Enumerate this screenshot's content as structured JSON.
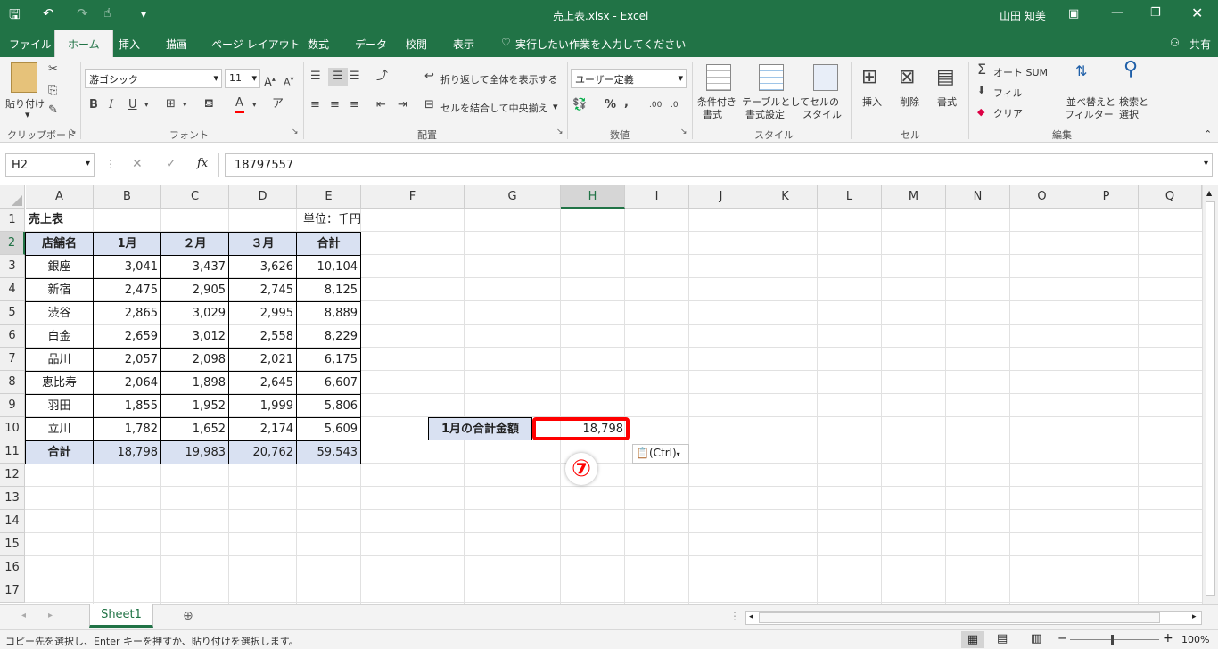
{
  "window": {
    "title": "売上表.xlsx - Excel",
    "user": "山田 知美"
  },
  "tabs": [
    "ファイル",
    "ホーム",
    "挿入",
    "描画",
    "ページ レイアウト",
    "数式",
    "データ",
    "校閲",
    "表示"
  ],
  "tell_me": "実行したい作業を入力してください",
  "share": "共有",
  "ribbon": {
    "clipboard": {
      "paste": "貼り付け",
      "label": "クリップボード"
    },
    "font": {
      "name": "游ゴシック",
      "size": "11",
      "label": "フォント"
    },
    "alignment": {
      "wrap": "折り返して全体を表示する",
      "merge": "セルを結合して中央揃え",
      "label": "配置"
    },
    "number": {
      "format": "ユーザー定義",
      "label": "数値"
    },
    "styles": {
      "cond": [
        "条件付き",
        "書式"
      ],
      "table": [
        "テーブルとして",
        "書式設定"
      ],
      "cell": [
        "セルの",
        "スタイル"
      ],
      "label": "スタイル"
    },
    "cells": {
      "insert": "挿入",
      "delete": "削除",
      "format": "書式",
      "label": "セル"
    },
    "editing": {
      "autosum": "オート SUM",
      "fill": "フィル",
      "clear": "クリア",
      "sort": [
        "並べ替えと",
        "フィルター"
      ],
      "find": [
        "検索と",
        "選択"
      ],
      "label": "編集"
    }
  },
  "formula_bar": {
    "name_box": "H2",
    "value": "18797557"
  },
  "columns": [
    "A",
    "B",
    "C",
    "D",
    "E",
    "F",
    "G",
    "H",
    "I",
    "J",
    "K",
    "L",
    "M",
    "N",
    "O",
    "P",
    "Q"
  ],
  "rows": [
    "1",
    "2",
    "3",
    "4",
    "5",
    "6",
    "7",
    "8",
    "9",
    "10",
    "11",
    "12",
    "13",
    "14",
    "15",
    "16",
    "17"
  ],
  "table": {
    "title": "売上表",
    "unit": "単位：千円",
    "headers": [
      "店舗名",
      "1月",
      "２月",
      "３月",
      "合計"
    ],
    "data": [
      [
        "銀座",
        "3,041",
        "3,437",
        "3,626",
        "10,104"
      ],
      [
        "新宿",
        "2,475",
        "2,905",
        "2,745",
        "8,125"
      ],
      [
        "渋谷",
        "2,865",
        "3,029",
        "2,995",
        "8,889"
      ],
      [
        "白金",
        "2,659",
        "3,012",
        "2,558",
        "8,229"
      ],
      [
        "品川",
        "2,057",
        "2,098",
        "2,021",
        "6,175"
      ],
      [
        "恵比寿",
        "2,064",
        "1,898",
        "2,645",
        "6,607"
      ],
      [
        "羽田",
        "1,855",
        "1,952",
        "1,999",
        "5,806"
      ],
      [
        "立川",
        "1,782",
        "1,652",
        "2,174",
        "5,609"
      ]
    ],
    "total": [
      "合計",
      "18,798",
      "19,983",
      "20,762",
      "59,543"
    ]
  },
  "side": {
    "label": "1月の合計金額",
    "value": "18,798"
  },
  "step_marker": "⑦",
  "paste_options": "(Ctrl)",
  "sheet_tab": "Sheet1",
  "status": {
    "message": "コピー先を選択し、Enter キーを押すか、貼り付けを選択します。",
    "zoom": "100%"
  },
  "colors": {
    "excel_green": "#217346",
    "header_fill": "#d9e1f2",
    "highlight": "#ff0000"
  }
}
